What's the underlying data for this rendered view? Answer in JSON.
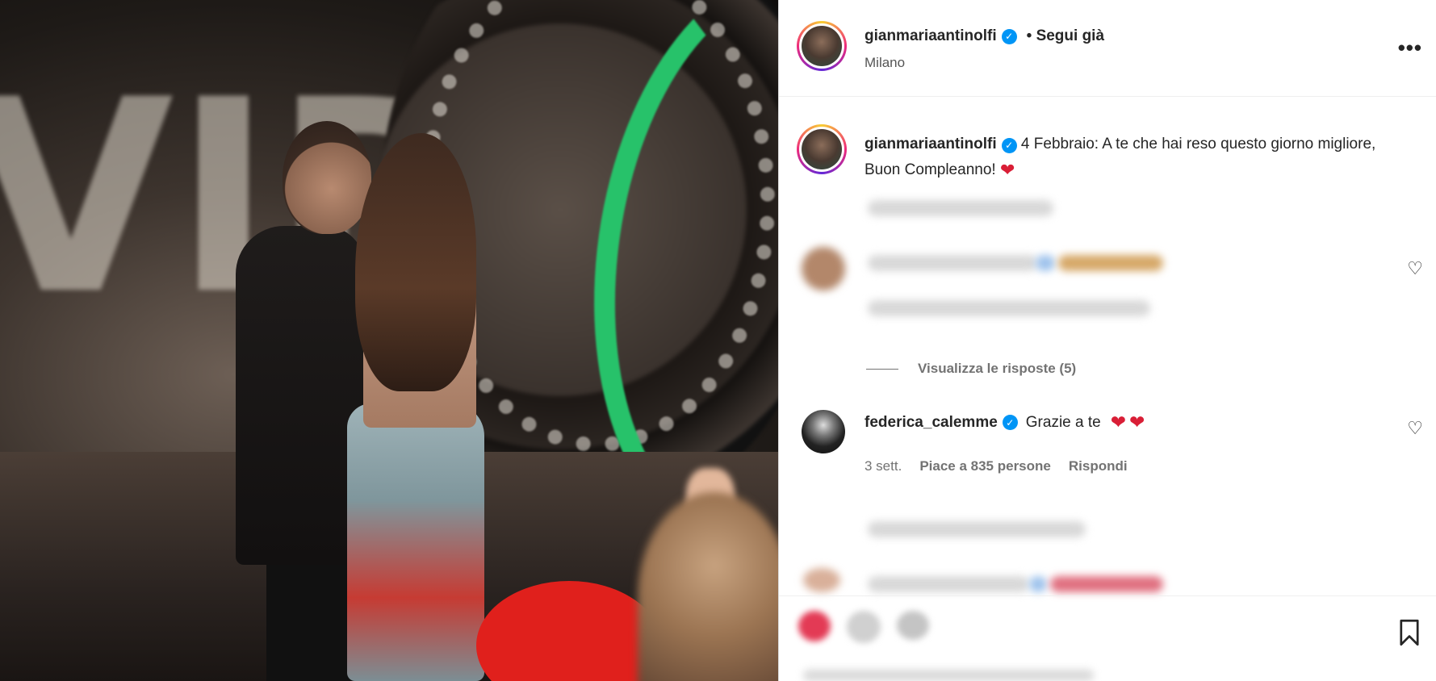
{
  "post": {
    "author": "gianmariaantinolfi",
    "follow_status": "• Segui già",
    "location": "Milano",
    "caption_author": "gianmariaantinolfi",
    "caption_text": "4 Febbraio: A te che hai reso questo giorno migliore, Buon Compleanno!",
    "caption_emoji": "❤"
  },
  "comments": {
    "view_replies": "Visualizza le risposte (5)",
    "featured": {
      "username": "federica_calemme",
      "text": "Grazie a te",
      "emojis": "❤❤",
      "time": "3 sett.",
      "likes": "Piace a 835 persone",
      "reply": "Rispondi"
    }
  },
  "icons": {
    "more": "more-options-icon",
    "like": "heart-outline-icon",
    "bookmark": "bookmark-icon",
    "verified": "verified-badge-icon"
  },
  "colors": {
    "verified": "#0095f6",
    "heart": "#d91e36",
    "muted_text": "#737373",
    "green_arc": "#27c26a"
  }
}
